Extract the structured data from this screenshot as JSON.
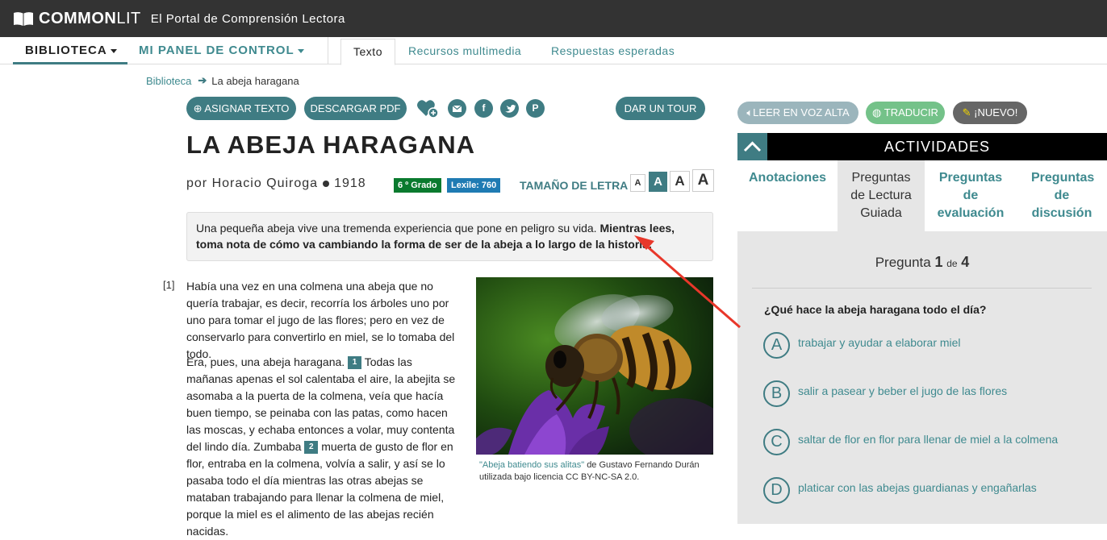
{
  "header": {
    "logo_bold": "COMMON",
    "logo_light": "LIT",
    "tagline": "El Portal de Comprensión Lectora"
  },
  "nav": {
    "biblioteca": "BIBLIOTECA",
    "panel": "MI PANEL DE CONTROL",
    "tabs": [
      "Texto",
      "Recursos multimedia",
      "Respuestas esperadas"
    ]
  },
  "breadcrumb": {
    "root": "Biblioteca",
    "current": "La abeja haragana"
  },
  "actions": {
    "asignar": "ASIGNAR TEXTO",
    "descargar": "DESCARGAR PDF",
    "tour": "DAR UN TOUR"
  },
  "text": {
    "title": "LA ABEJA HARAGANA",
    "by_prefix": "por",
    "author": "Horacio Quiroga",
    "year": "1918",
    "grade": "6 º Grado",
    "lexile": "Lexile: 760",
    "font_size_label": "TAMAÑO DE LETRA",
    "font_sizes": [
      "A",
      "A",
      "A",
      "A"
    ],
    "intro_plain": "Una pequeña abeja vive una tremenda experiencia que pone en peligro su vida.",
    "intro_bold": "Mientras lees, toma nota de cómo va cambiando la forma de ser de la abeja a lo largo de la historia.",
    "paragraph_number": "[1]",
    "p1": "Había una vez en una colmena una abeja que no quería trabajar, es decir, recorría los árboles uno por uno para tomar el jugo de las flores; pero en vez de conservarlo para convertirlo en miel, se lo tomaba del todo.",
    "p2_a": "Era, pues, una abeja haragana.",
    "note1": "1",
    "p2_b": "Todas las mañanas apenas el sol calentaba el aire, la abejita se asomaba a la puerta de la colmena, veía que hacía buen tiempo, se peinaba con las patas, como hacen las moscas, y echaba entonces a volar, muy contenta del lindo día. Zumbaba",
    "note2": "2",
    "p2_c": "muerta de gusto de flor en flor, entraba en la colmena, volvía a salir, y así se lo pasaba todo el día mientras las otras abejas se mataban trabajando para llenar la colmena de miel, porque la miel es el alimento de las abejas recién nacidas.",
    "caption_link": "\"Abeja batiendo sus alitas\"",
    "caption_rest": "de Gustavo Fernando Durán utilizada bajo licencia CC BY-NC-SA 2.0."
  },
  "tools": {
    "leer": "LEER EN VOZ ALTA",
    "traducir": "TRADUCIR",
    "nuevo": "¡NUEVO!"
  },
  "activities": {
    "title": "ACTIVIDADES",
    "tabs": [
      "Anotaciones",
      "Preguntas de Lectura Guiada",
      "Preguntas de evaluación",
      "Preguntas de discusión"
    ],
    "counter_label": "Pregunta",
    "counter_current": "1",
    "counter_of": "de",
    "counter_total": "4",
    "question": "¿Qué hace la abeja haragana todo el día?",
    "answers": [
      {
        "letter": "A",
        "text": "trabajar y ayudar a elaborar miel"
      },
      {
        "letter": "B",
        "text": "salir a pasear y beber el jugo de las flores"
      },
      {
        "letter": "C",
        "text": "saltar de flor en flor para llenar de miel a la colmena"
      },
      {
        "letter": "D",
        "text": "platicar con las abejas guardianas y engañarlas"
      }
    ]
  },
  "colors": {
    "teal": "#3f7c83",
    "dark_header": "#333333",
    "grade_green": "#0a7a2e",
    "lexile_blue": "#1f7bb3",
    "annotation_arrow": "#e8372a"
  }
}
